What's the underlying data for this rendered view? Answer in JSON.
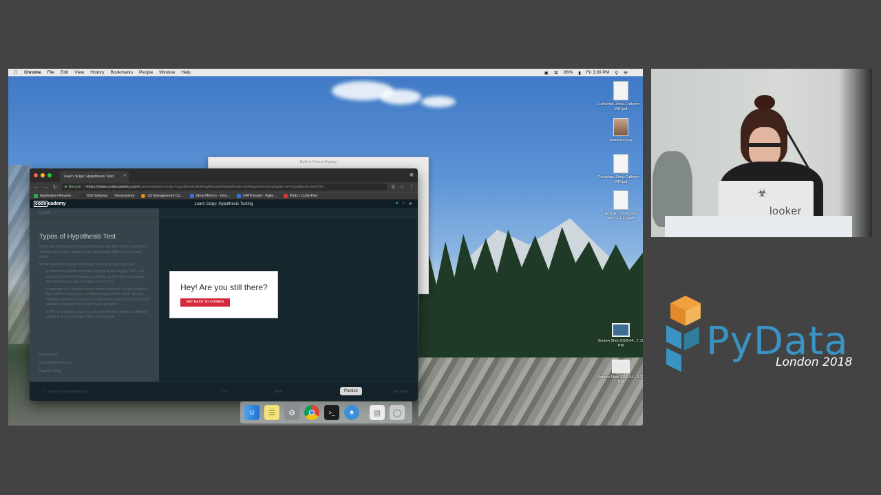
{
  "menubar": {
    "app_name": "Chrome",
    "items": [
      "File",
      "Edit",
      "View",
      "History",
      "Bookmarks",
      "People",
      "Window",
      "Help"
    ],
    "battery": "86%",
    "clock": "Fri 3:39 PM"
  },
  "desktop_icons": [
    {
      "label": "Catherine-Zhou-Catherin...-WIP.pdf",
      "kind": "doc"
    },
    {
      "label": "headshot.jpg",
      "kind": "photo"
    },
    {
      "label": "Catherine-Zhou-Catherin...-WIP.pdf",
      "kind": "doc"
    },
    {
      "label": "Amtrak... ticket and Rec...RGEN.pdf",
      "kind": "doc"
    },
    {
      "label": "Screen Shot 2018-04...7.19 PM",
      "kind": "shot"
    },
    {
      "label": "Screen Shot 2018-04...0.33 PM",
      "kind": "shot"
    }
  ],
  "retina_window": {
    "title": "Built-in Retina Display"
  },
  "chrome": {
    "tab_title": "Learn Scipy: Hypothesis Testi",
    "secure_label": "Secure",
    "url_host": "https://www.codecademy.com",
    "url_path": "/courses/learn-scipy-hypothesis-testing/lessons/hypothesis-testing/exercises/types-of-hypothesis-test?sh...",
    "bookmarks": [
      {
        "label": "Application Review...",
        "color": "#2eaa55"
      },
      {
        "label": "IOA Syllabus",
        "color": "#333333"
      },
      {
        "label": "Sevenpoints",
        "color": "#555555"
      },
      {
        "label": "S3 Management Co...",
        "color": "#f08a1c"
      },
      {
        "label": "Ideal Metrics - Goo...",
        "color": "#3b6fd8"
      },
      {
        "label": "DATA board - Agile...",
        "color": "#2a73d9"
      },
      {
        "label": "Pads | CoderPad",
        "color": "#d33636"
      }
    ]
  },
  "codecademy": {
    "logo_a": "code",
    "logo_b": "cademy",
    "course_title": "Learn Scipy: Hypothesis Testing",
    "crumb": "LEARN",
    "lesson_title": "Types of Hypothesis Test",
    "paragraphs": [
      "When we are trying to compare datasets, we often need a way to be confident knowing if datasets are significantly different from each other.",
      "Some situations involve correlating numerical data, such as:"
    ],
    "bullets": [
      "a professor expects an exam average to be roughly 75%, and wants to know if the actual scores line up with this expectation. Was the test actually too easy or too hard?",
      "a manager of a chain of stores wants to know if certain locations have different revenues on different days of the week. Are the revenue differences a result of natural fluctuations or a significant difference between the stores' sales patterns?",
      "a PM for a website wants to compare the time spent on different versions of a homepage. Does one version"
    ],
    "left_links": [
      "Instructions",
      "Community Forums",
      "Report a Bug"
    ],
    "footer": {
      "exercise": "1. Types of Hypothesis Test",
      "progress": "1/10",
      "next": "Next",
      "help": "Get Help"
    }
  },
  "modal": {
    "heading": "Hey! Are you still there?",
    "button": "GET BACK TO CODING!"
  },
  "dock": {
    "icons": [
      "finder-icon",
      "notes-icon",
      "system-preferences-icon",
      "chrome-icon",
      "terminal-icon",
      "postico-icon",
      "files-icon",
      "trash-icon"
    ],
    "tooltip": "Postico"
  },
  "speaker": {
    "laptop_brand": "looker"
  },
  "pydata": {
    "brand": "PyData",
    "subtitle": "London 2018",
    "colors": {
      "blue": "#3a93c2",
      "orange": "#f0a03c",
      "teal": "#2f7d9a"
    }
  }
}
